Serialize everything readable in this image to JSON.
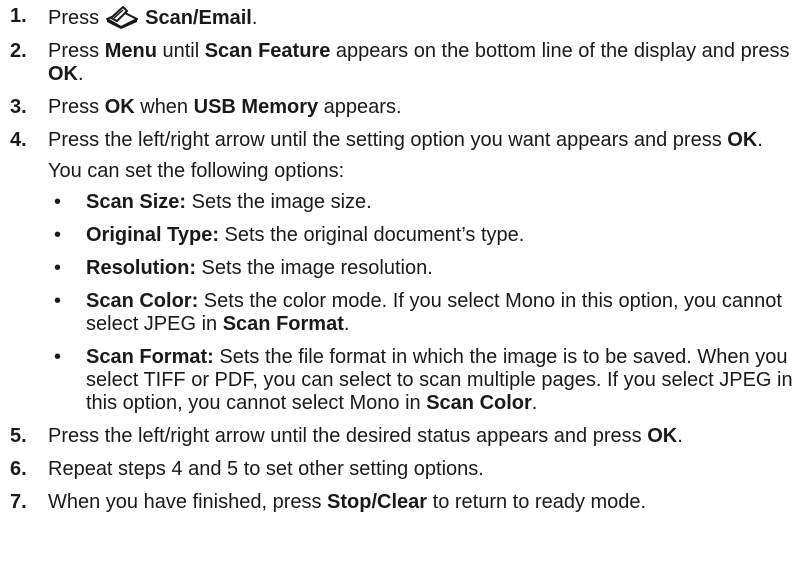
{
  "steps": [
    {
      "num": "1.",
      "parts": [
        {
          "t": "Press"
        },
        {
          "icon": "scanner-icon"
        },
        {
          "t": "Scan/Email",
          "b": true
        },
        {
          "t": "."
        }
      ]
    },
    {
      "num": "2.",
      "parts": [
        {
          "t": "Press "
        },
        {
          "t": "Menu",
          "b": true
        },
        {
          "t": " until "
        },
        {
          "t": "Scan Feature",
          "b": true
        },
        {
          "t": " appears on the bottom line of the display and press "
        },
        {
          "t": "OK",
          "b": true
        },
        {
          "t": "."
        }
      ]
    },
    {
      "num": "3.",
      "parts": [
        {
          "t": "Press "
        },
        {
          "t": "OK",
          "b": true
        },
        {
          "t": " when "
        },
        {
          "t": "USB Memory",
          "b": true
        },
        {
          "t": " appears."
        }
      ]
    },
    {
      "num": "4.",
      "parts": [
        {
          "t": "Press the left/right arrow until the setting option you want appears and press "
        },
        {
          "t": "OK",
          "b": true
        },
        {
          "t": "."
        }
      ],
      "subtext": "You can set the following options:",
      "options": [
        [
          {
            "t": "Scan Size:",
            "b": true
          },
          {
            "t": "  Sets the image size."
          }
        ],
        [
          {
            "t": "Original Type:",
            "b": true
          },
          {
            "t": "  Sets the original document’s type."
          }
        ],
        [
          {
            "t": "Resolution:",
            "b": true
          },
          {
            "t": "  Sets the image resolution."
          }
        ],
        [
          {
            "t": "Scan Color:",
            "b": true
          },
          {
            "t": "  Sets the color mode. If you select Mono in this option, you cannot select JPEG in "
          },
          {
            "t": "Scan Format",
            "b": true
          },
          {
            "t": "."
          }
        ],
        [
          {
            "t": "Scan Format:",
            "b": true
          },
          {
            "t": "  Sets the file format in which the image is to be saved. When you select TIFF or PDF, you can select to scan multiple pages. If you select JPEG in this option, you cannot select Mono in "
          },
          {
            "t": "Scan Color",
            "b": true
          },
          {
            "t": "."
          }
        ]
      ]
    },
    {
      "num": "5.",
      "parts": [
        {
          "t": "Press the left/right arrow until the desired status appears and press "
        },
        {
          "t": "OK",
          "b": true
        },
        {
          "t": "."
        }
      ]
    },
    {
      "num": "6.",
      "parts": [
        {
          "t": "Repeat steps 4 and 5 to set other setting options."
        }
      ]
    },
    {
      "num": "7.",
      "parts": [
        {
          "t": "When you have finished, press "
        },
        {
          "t": "Stop/Clear",
          "b": true
        },
        {
          "t": " to return to ready mode."
        }
      ]
    }
  ],
  "bullet": "•"
}
